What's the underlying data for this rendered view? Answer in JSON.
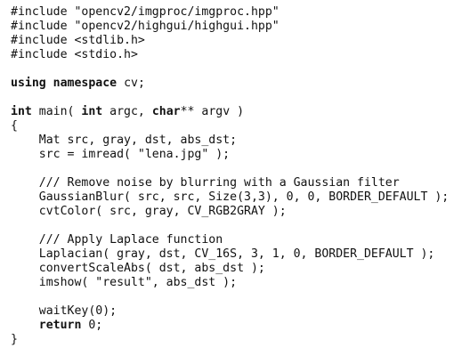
{
  "code_lines": [
    {
      "parts": [
        {
          "t": "#include \"opencv2/imgproc/imgproc.hpp\""
        }
      ]
    },
    {
      "parts": [
        {
          "t": "#include \"opencv2/highgui/highgui.hpp\""
        }
      ]
    },
    {
      "parts": [
        {
          "t": "#include <stdlib.h>"
        }
      ]
    },
    {
      "parts": [
        {
          "t": "#include <stdio.h>"
        }
      ]
    },
    {
      "parts": []
    },
    {
      "parts": [
        {
          "t": "using",
          "kw": true
        },
        {
          "t": " "
        },
        {
          "t": "namespace",
          "kw": true
        },
        {
          "t": " cv;"
        }
      ]
    },
    {
      "parts": []
    },
    {
      "parts": [
        {
          "t": "int",
          "kw": true
        },
        {
          "t": " main( "
        },
        {
          "t": "int",
          "kw": true
        },
        {
          "t": " argc, "
        },
        {
          "t": "char",
          "kw": true
        },
        {
          "t": "** argv )"
        }
      ]
    },
    {
      "parts": [
        {
          "t": "{"
        }
      ]
    },
    {
      "parts": [
        {
          "t": "    Mat src, gray, dst, abs_dst;"
        }
      ]
    },
    {
      "parts": [
        {
          "t": "    src = imread( \"lena.jpg\" );"
        }
      ]
    },
    {
      "parts": []
    },
    {
      "parts": [
        {
          "t": "    /// Remove noise by blurring with a Gaussian filter"
        }
      ]
    },
    {
      "parts": [
        {
          "t": "    GaussianBlur( src, src, Size(3,3), 0, 0, BORDER_DEFAULT );"
        }
      ]
    },
    {
      "parts": [
        {
          "t": "    cvtColor( src, gray, CV_RGB2GRAY );"
        }
      ]
    },
    {
      "parts": []
    },
    {
      "parts": [
        {
          "t": "    /// Apply Laplace function"
        }
      ]
    },
    {
      "parts": [
        {
          "t": "    Laplacian( gray, dst, CV_16S, 3, 1, 0, BORDER_DEFAULT );"
        }
      ]
    },
    {
      "parts": [
        {
          "t": "    convertScaleAbs( dst, abs_dst );"
        }
      ]
    },
    {
      "parts": [
        {
          "t": "    imshow( \"result\", abs_dst );"
        }
      ]
    },
    {
      "parts": []
    },
    {
      "parts": [
        {
          "t": "    waitKey(0);"
        }
      ]
    },
    {
      "parts": [
        {
          "t": "    "
        },
        {
          "t": "return",
          "kw": true
        },
        {
          "t": " 0;"
        }
      ]
    },
    {
      "parts": [
        {
          "t": "}"
        }
      ]
    }
  ]
}
